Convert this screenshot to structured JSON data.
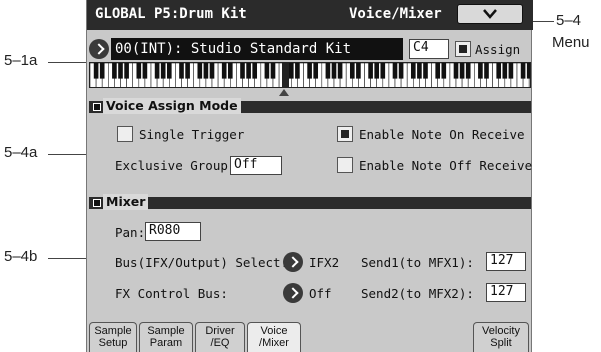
{
  "title": {
    "left": "GLOBAL P5:Drum Kit",
    "right": "Voice/Mixer"
  },
  "menu": {
    "chevron": "⌄",
    "icon": "chevron-down-icon"
  },
  "drumkit": {
    "name": "00(INT): Studio Standard Kit",
    "note": "C4",
    "assign_label": "Assign",
    "assign_checked": true
  },
  "voice_assign": {
    "title": "Voice Assign Mode",
    "single_trigger": {
      "label": "Single Trigger",
      "checked": false
    },
    "enable_note_on": {
      "label": "Enable Note On Receive",
      "checked": true
    },
    "exclusive_group": {
      "label": "Exclusive Group:",
      "value": "Off"
    },
    "enable_note_off": {
      "label": "Enable Note Off Receive",
      "checked": false
    }
  },
  "mixer": {
    "title": "Mixer",
    "pan": {
      "label": "Pan:",
      "value": "R080"
    },
    "bus_select": {
      "label": "Bus(IFX/Output) Select:",
      "value": "IFX2"
    },
    "send1": {
      "label": "Send1(to MFX1):",
      "value": "127"
    },
    "fx_control": {
      "label": "FX Control Bus:",
      "value": "Off"
    },
    "send2": {
      "label": "Send2(to MFX2):",
      "value": "127"
    }
  },
  "tabs": [
    {
      "l1": "Sample",
      "l2": "Setup",
      "active": false
    },
    {
      "l1": "Sample",
      "l2": "Param",
      "active": false
    },
    {
      "l1": "Driver",
      "l2": "/EQ",
      "active": false
    },
    {
      "l1": "Voice",
      "l2": "/Mixer",
      "active": true
    },
    {
      "l1": "Velocity",
      "l2": "Split",
      "active": false
    }
  ],
  "callouts": {
    "menu_ref": "5–4",
    "menu_label": "Menu",
    "kit_ref": "5–1a",
    "voice_ref": "5–4a",
    "mixer_ref": "5–4b"
  }
}
